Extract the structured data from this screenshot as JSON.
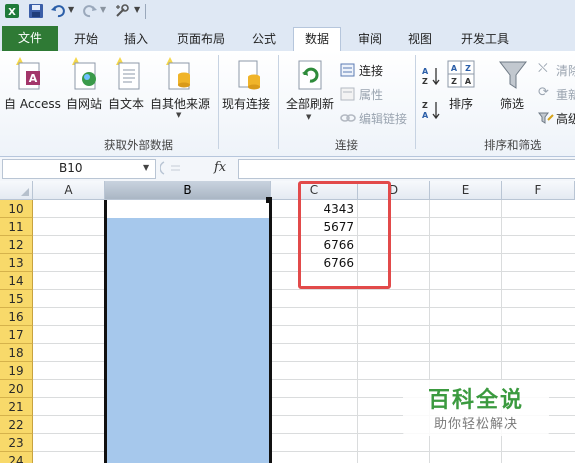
{
  "qat": {
    "icons": [
      "excel-icon",
      "save-icon",
      "undo-icon",
      "redo-icon",
      "customize-icon"
    ]
  },
  "tabs": [
    {
      "label": "文件"
    },
    {
      "label": "开始"
    },
    {
      "label": "插入"
    },
    {
      "label": "页面布局"
    },
    {
      "label": "公式"
    },
    {
      "label": "数据"
    },
    {
      "label": "审阅"
    },
    {
      "label": "视图"
    },
    {
      "label": "开发工具"
    }
  ],
  "active_tab": "数据",
  "ribbon": {
    "external": {
      "from_access": "自 Access",
      "from_web": "自网站",
      "from_text": "自文本",
      "from_other": "自其他来源",
      "existing": "现有连接",
      "group": "获取外部数据"
    },
    "connections": {
      "refresh_all": "全部刷新",
      "connections": "连接",
      "properties": "属性",
      "edit_links": "编辑链接",
      "group": "连接"
    },
    "sort_filter": {
      "sort": "排序",
      "filter": "筛选",
      "clear": "清除",
      "reapply": "重新",
      "advanced": "高级",
      "group": "排序和筛选"
    }
  },
  "formula_bar": {
    "name_box": "B10",
    "fx": "fx",
    "content": ""
  },
  "columns": [
    "A",
    "B",
    "C",
    "D",
    "E",
    "F"
  ],
  "rows": [
    "10",
    "11",
    "12",
    "13",
    "14",
    "15",
    "16",
    "17",
    "18",
    "19",
    "20",
    "21",
    "22",
    "23",
    "24"
  ],
  "column_c_values": [
    "4343",
    "5677",
    "6766",
    "6766"
  ],
  "selected_column": "B",
  "colors": {
    "file_tab": "#2f7a35",
    "selection_fill": "#a6c8ec",
    "row_header": "#f8d96a",
    "highlight_box": "#e24a4a"
  },
  "watermark": {
    "title": "百科全说",
    "subtitle": "助你轻松解决"
  }
}
